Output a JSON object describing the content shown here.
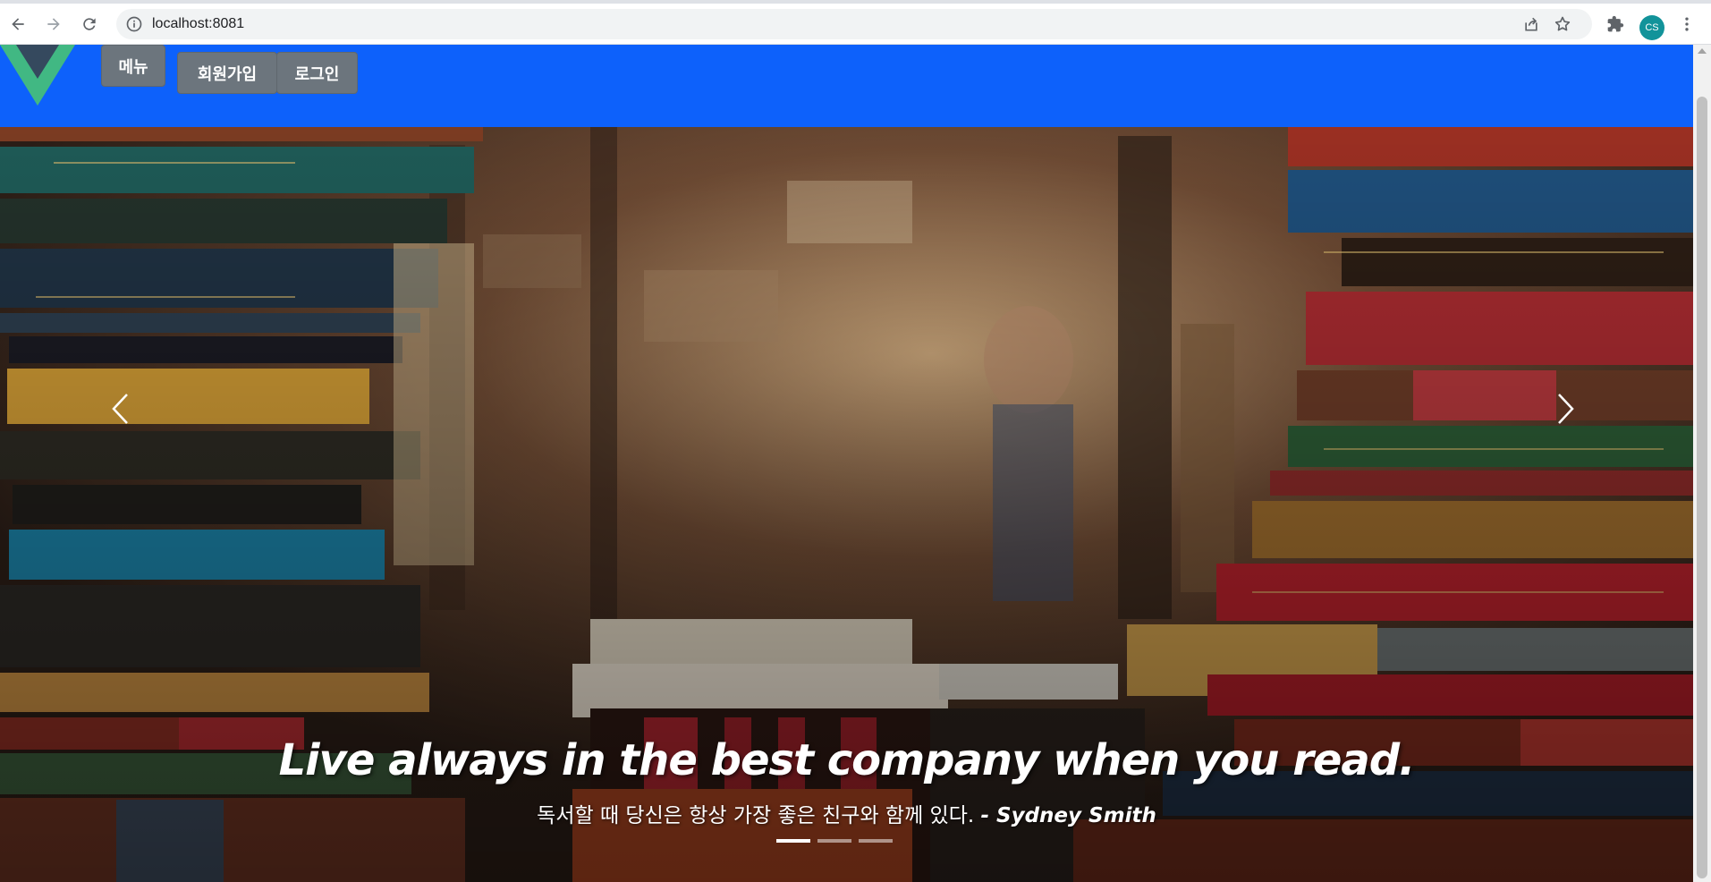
{
  "browser": {
    "url": "localhost:8081",
    "profile_initials": "CS",
    "icons": [
      "back-arrow-icon",
      "forward-arrow-icon",
      "reload-icon",
      "info-icon",
      "share-icon",
      "star-icon",
      "extensions-icon",
      "more-vert-icon"
    ]
  },
  "navbar": {
    "color": "#0d61fb",
    "logo": "vue-logo-icon",
    "menu_label": "메뉴",
    "signup_label": "회원가입",
    "login_label": "로그인"
  },
  "hero": {
    "title": "Live always in the best company when you read.",
    "subtitle": "독서할 때 당신은 항상 가장 좋은 친구와 함께 있다. ",
    "author": "- Sydney Smith",
    "prev_icon": "chevron-left-icon",
    "next_icon": "chevron-right-icon",
    "slide_count": 3,
    "active_slide": 1
  }
}
